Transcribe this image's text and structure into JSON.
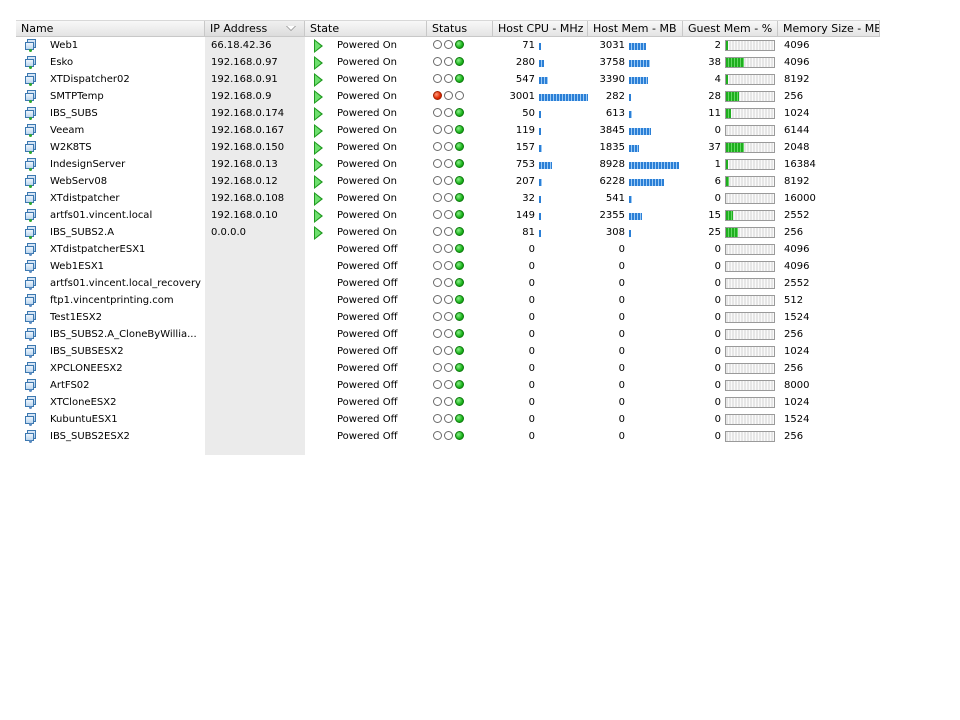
{
  "columns": {
    "name": "Name",
    "ip": "IP Address",
    "state": "State",
    "status": "Status",
    "cpu": "Host CPU - MHz",
    "hmem": "Host Mem - MB",
    "gmem": "Guest Mem - %",
    "msize": "Memory Size - MB"
  },
  "sorted_column": "ip",
  "colors": {
    "bar_blue": "#2b7fd6",
    "gauge_green": "#1fae1f",
    "alert_red": "#e02800",
    "ok_green": "#1cb41c"
  },
  "rows": [
    {
      "name": "Web1",
      "ip": "66.18.42.36",
      "state": "Powered On",
      "power": "on",
      "status": "green",
      "cpu": "71",
      "hmem": "3031",
      "gmem": "2",
      "msize": "4096"
    },
    {
      "name": "Esko",
      "ip": "192.168.0.97",
      "state": "Powered On",
      "power": "on",
      "status": "green",
      "cpu": "280",
      "hmem": "3758",
      "gmem": "38",
      "msize": "4096"
    },
    {
      "name": "XTDispatcher02",
      "ip": "192.168.0.91",
      "state": "Powered On",
      "power": "on",
      "status": "green",
      "cpu": "547",
      "hmem": "3390",
      "gmem": "4",
      "msize": "8192"
    },
    {
      "name": "SMTPTemp",
      "ip": "192.168.0.9",
      "state": "Powered On",
      "power": "on",
      "status": "red",
      "cpu": "3001",
      "hmem": "282",
      "gmem": "28",
      "msize": "256"
    },
    {
      "name": "IBS_SUBS",
      "ip": "192.168.0.174",
      "state": "Powered On",
      "power": "on",
      "status": "green",
      "cpu": "50",
      "hmem": "613",
      "gmem": "11",
      "msize": "1024"
    },
    {
      "name": "Veeam",
      "ip": "192.168.0.167",
      "state": "Powered On",
      "power": "on",
      "status": "green",
      "cpu": "119",
      "hmem": "3845",
      "gmem": "0",
      "msize": "6144"
    },
    {
      "name": "W2K8TS",
      "ip": "192.168.0.150",
      "state": "Powered On",
      "power": "on",
      "status": "green",
      "cpu": "157",
      "hmem": "1835",
      "gmem": "37",
      "msize": "2048"
    },
    {
      "name": "IndesignServer",
      "ip": "192.168.0.13",
      "state": "Powered On",
      "power": "on",
      "status": "green",
      "cpu": "753",
      "hmem": "8928",
      "gmem": "1",
      "msize": "16384"
    },
    {
      "name": "WebServ08",
      "ip": "192.168.0.12",
      "state": "Powered On",
      "power": "on",
      "status": "green",
      "cpu": "207",
      "hmem": "6228",
      "gmem": "6",
      "msize": "8192"
    },
    {
      "name": "XTdistpatcher",
      "ip": "192.168.0.108",
      "state": "Powered On",
      "power": "on",
      "status": "green",
      "cpu": "32",
      "hmem": "541",
      "gmem": "0",
      "msize": "16000"
    },
    {
      "name": "artfs01.vincent.local",
      "ip": "192.168.0.10",
      "state": "Powered On",
      "power": "on",
      "status": "green",
      "cpu": "149",
      "hmem": "2355",
      "gmem": "15",
      "msize": "2552"
    },
    {
      "name": "IBS_SUBS2.A",
      "ip": "0.0.0.0",
      "state": "Powered On",
      "power": "on",
      "status": "green",
      "cpu": "81",
      "hmem": "308",
      "gmem": "25",
      "msize": "256"
    },
    {
      "name": "XTdistpatcherESX1",
      "ip": "",
      "state": "Powered Off",
      "power": "off",
      "status": "green",
      "cpu": "0",
      "hmem": "0",
      "gmem": "0",
      "msize": "4096"
    },
    {
      "name": "Web1ESX1",
      "ip": "",
      "state": "Powered Off",
      "power": "off",
      "status": "green",
      "cpu": "0",
      "hmem": "0",
      "gmem": "0",
      "msize": "4096"
    },
    {
      "name": "artfs01.vincent.local_recovery",
      "ip": "",
      "state": "Powered Off",
      "power": "off",
      "status": "green",
      "cpu": "0",
      "hmem": "0",
      "gmem": "0",
      "msize": "2552"
    },
    {
      "name": "ftp1.vincentprinting.com",
      "ip": "",
      "state": "Powered Off",
      "power": "off",
      "status": "green",
      "cpu": "0",
      "hmem": "0",
      "gmem": "0",
      "msize": "512"
    },
    {
      "name": "Test1ESX2",
      "ip": "",
      "state": "Powered Off",
      "power": "off",
      "status": "green",
      "cpu": "0",
      "hmem": "0",
      "gmem": "0",
      "msize": "1524"
    },
    {
      "name": "IBS_SUBS2.A_CloneByWillia...",
      "ip": "",
      "state": "Powered Off",
      "power": "off",
      "status": "green",
      "cpu": "0",
      "hmem": "0",
      "gmem": "0",
      "msize": "256"
    },
    {
      "name": "IBS_SUBSESX2",
      "ip": "",
      "state": "Powered Off",
      "power": "off",
      "status": "green",
      "cpu": "0",
      "hmem": "0",
      "gmem": "0",
      "msize": "1024"
    },
    {
      "name": "XPCLONEESX2",
      "ip": "",
      "state": "Powered Off",
      "power": "off",
      "status": "green",
      "cpu": "0",
      "hmem": "0",
      "gmem": "0",
      "msize": "256"
    },
    {
      "name": "ArtFS02",
      "ip": "",
      "state": "Powered Off",
      "power": "off",
      "status": "green",
      "cpu": "0",
      "hmem": "0",
      "gmem": "0",
      "msize": "8000"
    },
    {
      "name": "XTCloneESX2",
      "ip": "",
      "state": "Powered Off",
      "power": "off",
      "status": "green",
      "cpu": "0",
      "hmem": "0",
      "gmem": "0",
      "msize": "1024"
    },
    {
      "name": "KubuntuESX1",
      "ip": "",
      "state": "Powered Off",
      "power": "off",
      "status": "green",
      "cpu": "0",
      "hmem": "0",
      "gmem": "0",
      "msize": "1524"
    },
    {
      "name": "IBS_SUBS2ESX2",
      "ip": "",
      "state": "Powered Off",
      "power": "off",
      "status": "green",
      "cpu": "0",
      "hmem": "0",
      "gmem": "0",
      "msize": "256"
    }
  ]
}
